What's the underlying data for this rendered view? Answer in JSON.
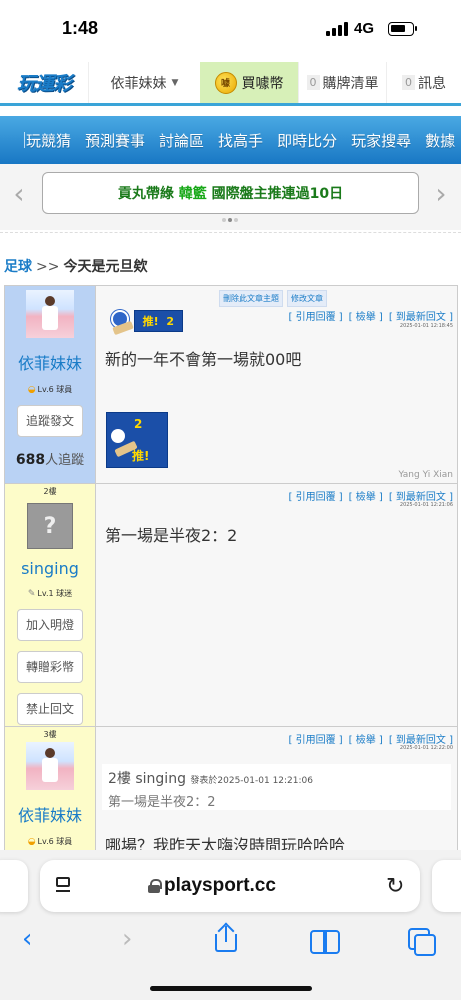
{
  "status": {
    "time": "1:48",
    "network": "4G"
  },
  "header": {
    "logo": "玩運彩",
    "user": "依菲妹妹",
    "buy_coin": "買噱幣",
    "coin_icon_text": "噱",
    "links": [
      {
        "count": "0",
        "label": "購牌清單"
      },
      {
        "count": "0",
        "label": "訊息"
      }
    ]
  },
  "menu": [
    "玩競猜",
    "預測賽事",
    "討論區",
    "找高手",
    "即時比分",
    "玩家搜尋",
    "數據"
  ],
  "marquee": {
    "prefix": "貢丸帶綠",
    "highlight": "韓籃",
    "suffix": "國際盤主推連過10日"
  },
  "breadcrumb": {
    "link": "足球",
    "sep": ">>",
    "title": "今天是元旦欸"
  },
  "common": {
    "quote": "[ 引用回覆 ]",
    "report": "[ 檢舉 ]",
    "latest": "[ 到最新回文 ]"
  },
  "posts": [
    {
      "floor": "",
      "nick": "依菲妹妹",
      "level": "Lv.6 球員",
      "mod_delete": "刪除此文章主題",
      "mod_edit": "修改文章",
      "time": "2025-01-01 12:18:45",
      "push_label": "推!",
      "push_count": "2",
      "text": "新的一年不會第一場就00吧",
      "big_push_count": "2",
      "big_push_label": "推!",
      "follow_btn": "追蹤發文",
      "followers_num": "688",
      "followers_label": "人追蹤",
      "signature": "Yang Yi Xian"
    },
    {
      "floor": "2樓",
      "nick": "singing",
      "level": "Lv.1 球迷",
      "time": "2025-01-01 12:21:06",
      "text": "第一場是半夜2：2",
      "buttons": [
        "加入明燈",
        "轉贈彩幣",
        "禁止回文"
      ]
    },
    {
      "floor": "3樓",
      "nick": "依菲妹妹",
      "level": "Lv.6 球員",
      "time": "2025-01-01 12:22:00",
      "quote_author": "2樓 singing",
      "quote_time": "發表於2025-01-01 12:21:06",
      "quote_text": "第一場是半夜2：2",
      "text": "哪場？我昨天太嗨沒時間玩哈哈哈"
    }
  ],
  "browser": {
    "url": "playsport.cc"
  }
}
